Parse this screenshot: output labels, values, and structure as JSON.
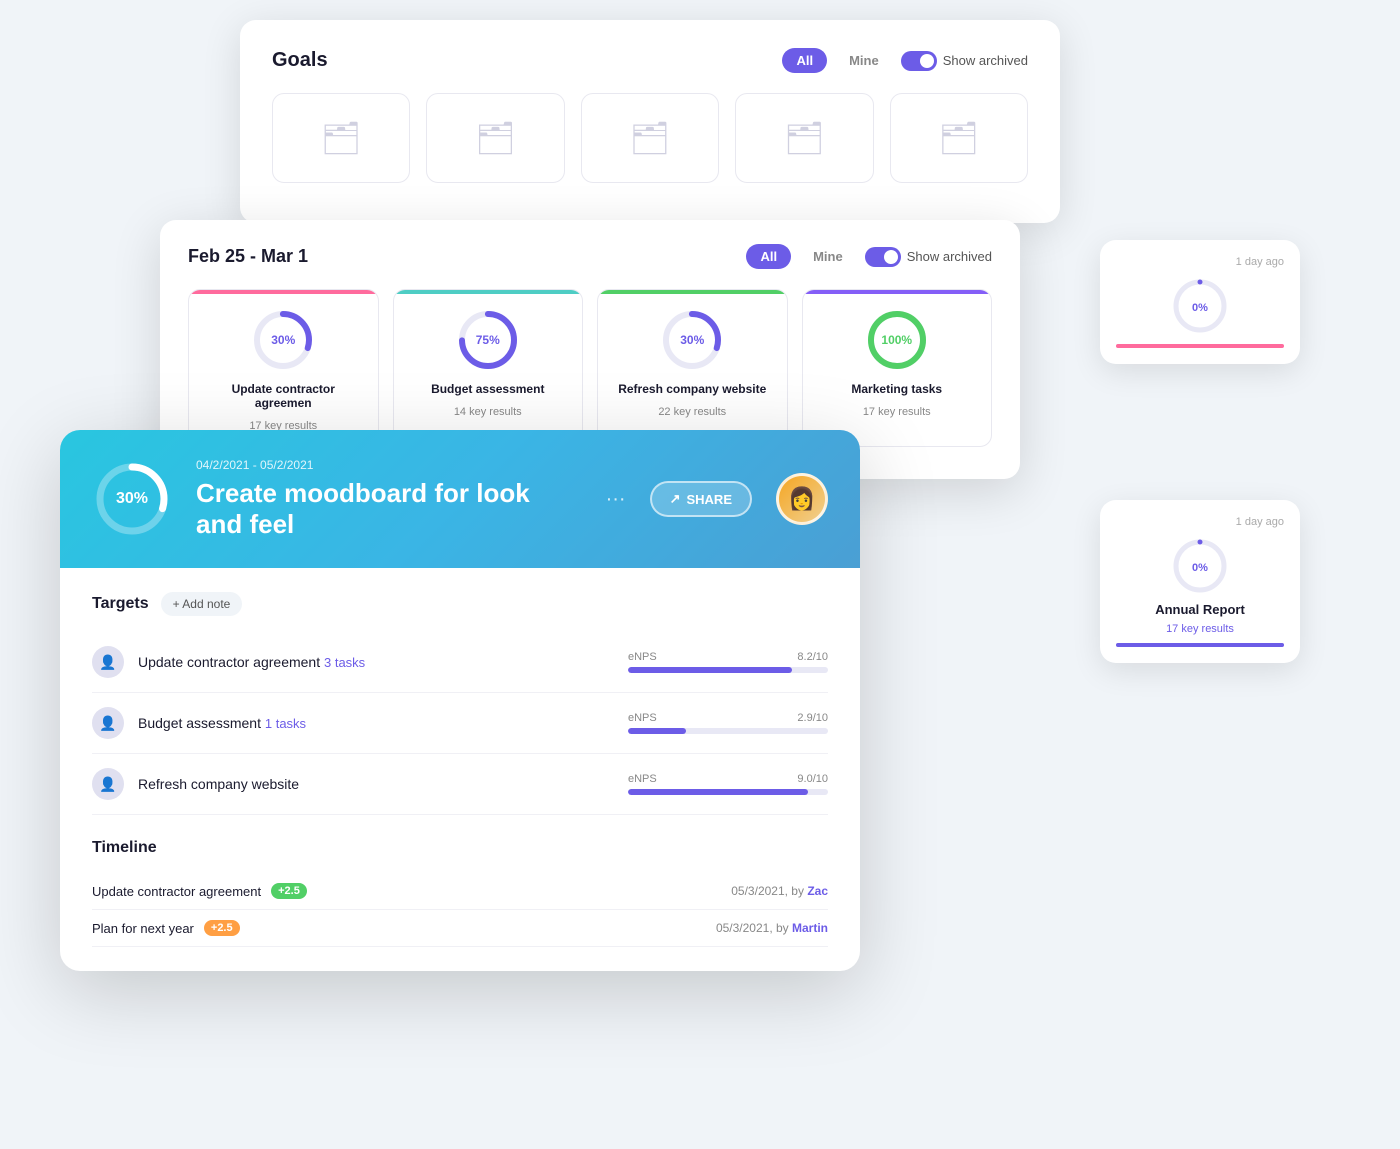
{
  "goals_card": {
    "title": "Goals",
    "filter_all": "All",
    "filter_mine": "Mine",
    "toggle_label": "Show archived",
    "folders": [
      {
        "id": 1
      },
      {
        "id": 2
      },
      {
        "id": 3
      },
      {
        "id": 4
      },
      {
        "id": 5
      }
    ]
  },
  "weekly_card": {
    "title": "Feb 25 - Mar 1",
    "filter_all": "All",
    "filter_mine": "Mine",
    "toggle_label": "Show archived",
    "goals": [
      {
        "name": "Update contractor agreemen",
        "sub": "17 key results",
        "percent": 30,
        "color": "pink",
        "donut_color": "#6c5ce7"
      },
      {
        "name": "Budget assessment",
        "sub": "14 key results",
        "percent": 75,
        "color": "blue",
        "donut_color": "#6c5ce7"
      },
      {
        "name": "Refresh company website",
        "sub": "22 key results",
        "percent": 30,
        "color": "green",
        "donut_color": "#6c5ce7"
      },
      {
        "name": "Marketing tasks",
        "sub": "17 key results",
        "percent": 100,
        "color": "purple",
        "donut_color": "#51cf66"
      }
    ]
  },
  "side_cards": [
    {
      "ago": "1 day ago",
      "name": "",
      "sub": "",
      "percent": 0,
      "bar": "pink"
    },
    {
      "ago": "1 day ago",
      "name": "Annual Report",
      "sub": "17 key results",
      "percent": 0,
      "bar": "purple"
    }
  ],
  "detail_card": {
    "date_range": "04/2/2021 - 05/2/2021",
    "title": "Create moodboard for look and feel",
    "percent": "30%",
    "share_label": "SHARE",
    "targets_title": "Targets",
    "add_note_label": "+ Add note",
    "targets": [
      {
        "name": "Update contractor agreement",
        "link": "3 tasks",
        "metric_label": "eNPS",
        "metric_value": "8.2/10",
        "fill_percent": 82,
        "avatar": "👤"
      },
      {
        "name": "Budget assessment",
        "link": "1 tasks",
        "metric_label": "eNPS",
        "metric_value": "2.9/10",
        "fill_percent": 29,
        "avatar": "👤"
      },
      {
        "name": "Refresh company website",
        "link": "",
        "metric_label": "eNPS",
        "metric_value": "9.0/10",
        "fill_percent": 90,
        "avatar": "👤"
      }
    ],
    "timeline_title": "Timeline",
    "timeline_rows": [
      {
        "name": "Update contractor agreement",
        "badge": "+2.5",
        "badge_type": "green",
        "date": "05/3/2021, by",
        "person": "Zac"
      },
      {
        "name": "Plan for next year",
        "badge": "+2.5",
        "badge_type": "orange",
        "date": "05/3/2021, by",
        "person": "Martin"
      }
    ]
  }
}
